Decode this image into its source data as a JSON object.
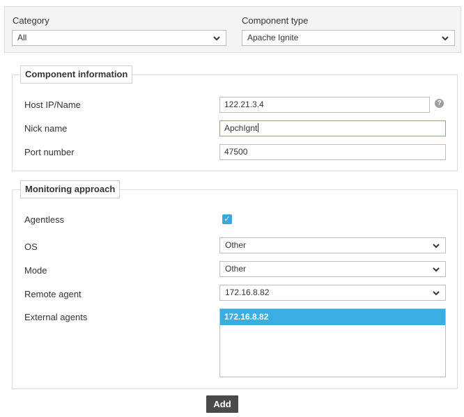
{
  "top": {
    "category_label": "Category",
    "category_value": "All",
    "component_type_label": "Component type",
    "component_type_value": "Apache Ignite"
  },
  "component_info": {
    "legend": "Component information",
    "host_label": "Host IP/Name",
    "host_value": "122.21.3.4",
    "help_glyph": "?",
    "nick_label": "Nick name",
    "nick_value": "ApchIgnt",
    "port_label": "Port number",
    "port_value": "47500"
  },
  "monitoring": {
    "legend": "Monitoring approach",
    "agentless_label": "Agentless",
    "agentless_checked": true,
    "os_label": "OS",
    "os_value": "Other",
    "mode_label": "Mode",
    "mode_value": "Other",
    "remote_label": "Remote agent",
    "remote_value": "172.16.8.82",
    "external_label": "External agents",
    "external_items": [
      "172.16.8.82"
    ]
  },
  "actions": {
    "add_label": "Add"
  },
  "colors": {
    "accent": "#3aaee0",
    "button": "#4a4a4a"
  },
  "icons": {
    "chevron": "chevron-down-icon",
    "help": "help-icon",
    "check": "checkmark-icon"
  }
}
